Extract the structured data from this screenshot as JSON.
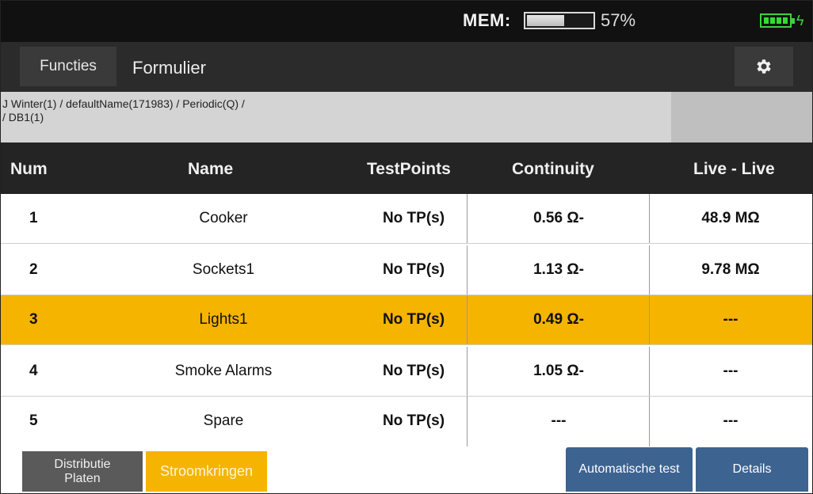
{
  "status": {
    "mem_label": "MEM:",
    "mem_percent_text": "57%",
    "mem_fill": 0.57,
    "battery_color": "#3fd03f"
  },
  "header": {
    "functies_label": "Functies",
    "formulier_label": "Formulier",
    "settings_icon": "gear-icon"
  },
  "breadcrumb": {
    "line1": "J Winter(1) / defaultName(171983) / Periodic(Q) /",
    "line2": "/ DB1(1)"
  },
  "table": {
    "columns": [
      "Num",
      "Name",
      "TestPoints",
      "Continuity",
      "Live - Live"
    ],
    "rows": [
      {
        "num": "1",
        "name": "Cooker",
        "testpoints": "No TP(s)",
        "continuity": "0.56 Ω-",
        "live_live": "48.9 MΩ",
        "selected": false
      },
      {
        "num": "2",
        "name": "Sockets1",
        "testpoints": "No TP(s)",
        "continuity": "1.13 Ω-",
        "live_live": "9.78 MΩ",
        "selected": false
      },
      {
        "num": "3",
        "name": "Lights1",
        "testpoints": "No TP(s)",
        "continuity": "0.49 Ω-",
        "live_live": "---",
        "selected": true
      },
      {
        "num": "4",
        "name": "Smoke Alarms",
        "testpoints": "No TP(s)",
        "continuity": "1.05 Ω-",
        "live_live": "---",
        "selected": false
      },
      {
        "num": "5",
        "name": "Spare",
        "testpoints": "No TP(s)",
        "continuity": "---",
        "live_live": "---",
        "selected": false
      }
    ]
  },
  "footer": {
    "distributie_line1": "Distributie",
    "distributie_line2": "Platen",
    "stroomkringen_label": "Stroomkringen",
    "automatische_label": "Automatische test",
    "details_label": "Details"
  },
  "colors": {
    "accent": "#f5b400",
    "button_blue": "#3d6390",
    "header_dark": "#242424"
  }
}
